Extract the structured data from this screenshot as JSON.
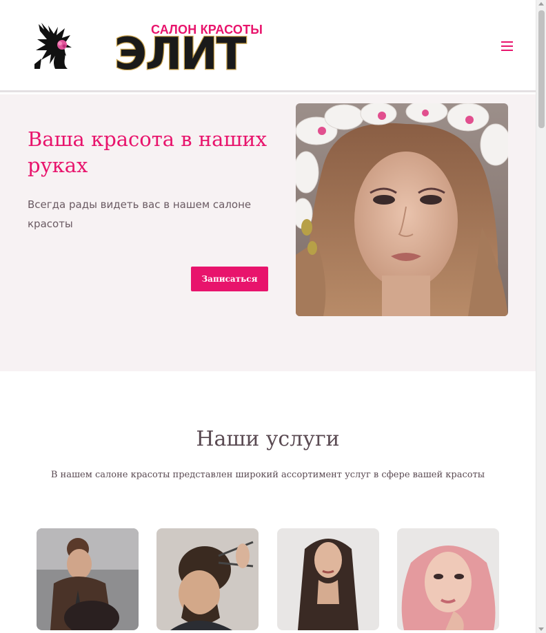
{
  "header": {
    "logo_subtitle": "САЛОН КРАСОТЫ",
    "logo_title": "ЭЛИТ",
    "menu_icon": "hamburger-menu-icon"
  },
  "hero": {
    "title": "Ваша красота в наших руках",
    "subtitle": "Всегда рады видеть вас в нашем салоне красоты",
    "cta_label": "Записаться"
  },
  "services": {
    "title": "Наши услуги",
    "subtitle": "В нашем салоне красоты представлен широкий ассортимент услуг в сфере вашей красоты",
    "cards": [
      {
        "image": "hairdresser-at-work"
      },
      {
        "image": "mens-haircut"
      },
      {
        "image": "long-straight-hair"
      },
      {
        "image": "pink-wavy-hair-makeup"
      }
    ]
  },
  "colors": {
    "accent": "#e8146c",
    "hero_bg": "#f7f2f3",
    "text": "#5a4a52"
  }
}
